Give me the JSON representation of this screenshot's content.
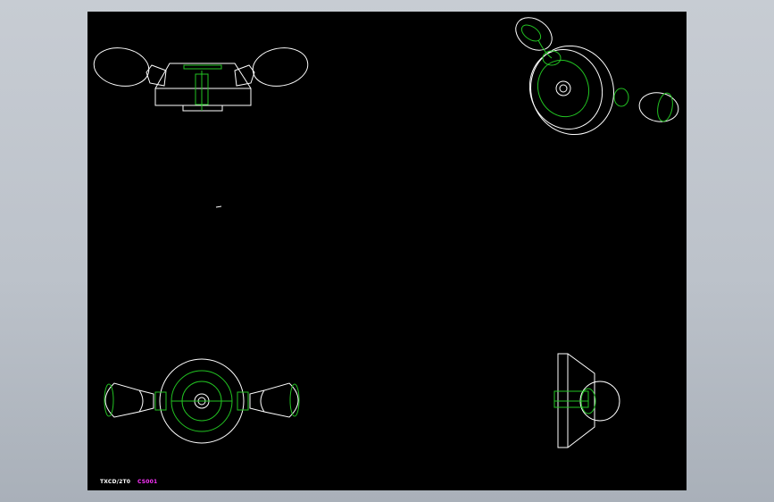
{
  "window": {
    "title": ""
  },
  "colors": {
    "background": "#000000",
    "edge": "#ffffff",
    "hidden_edge": "#22c322",
    "label_a": "#ffffff",
    "label_b": "#ff33ff",
    "frame": "#bcc2ca"
  },
  "labels": {
    "left": "TXCD/2T0",
    "right": "CS001"
  },
  "views": [
    "front-view",
    "isometric-view",
    "top-view",
    "side-view"
  ]
}
